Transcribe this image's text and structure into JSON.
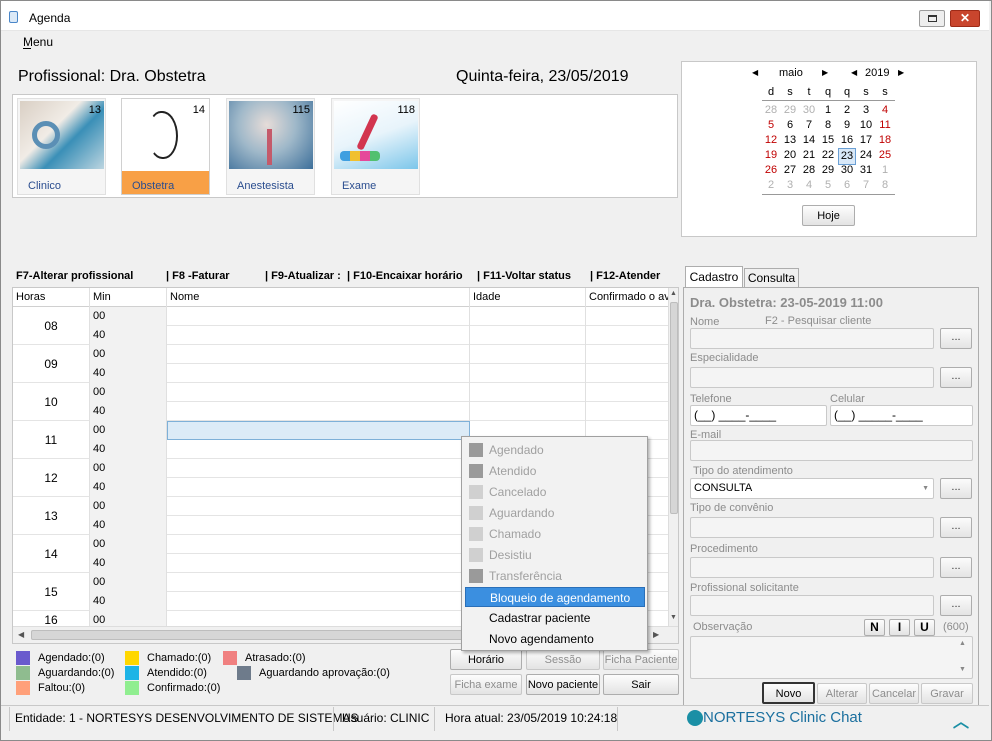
{
  "window": {
    "title": "Agenda",
    "menu": "Menu"
  },
  "header": {
    "profissional": "Profissional: Dra. Obstetra",
    "date": "Quinta-feira, 23/05/2019"
  },
  "categories": [
    {
      "label": "Clinico",
      "count": "13"
    },
    {
      "label": "Obstetra",
      "count": "14"
    },
    {
      "label": "Anestesista",
      "count": "115"
    },
    {
      "label": "Exame",
      "count": "118"
    }
  ],
  "calendar": {
    "month": "maio",
    "year": "2019",
    "weekdays": [
      "d",
      "s",
      "t",
      "q",
      "q",
      "s",
      "s"
    ],
    "weeks": [
      [
        "28",
        "29",
        "30",
        "1",
        "2",
        "3",
        "4"
      ],
      [
        "5",
        "6",
        "7",
        "8",
        "9",
        "10",
        "11"
      ],
      [
        "12",
        "13",
        "14",
        "15",
        "16",
        "17",
        "18"
      ],
      [
        "19",
        "20",
        "21",
        "22",
        "23",
        "24",
        "25"
      ],
      [
        "26",
        "27",
        "28",
        "29",
        "30",
        "31",
        "1"
      ],
      [
        "2",
        "3",
        "4",
        "5",
        "6",
        "7",
        "8"
      ]
    ],
    "today_button": "Hoje"
  },
  "shortcuts": {
    "f7": "F7-Alterar profissional",
    "f8": "| F8 -Faturar",
    "f9": "| F9-Atualizar :",
    "f10": "| F10-Encaixar horário",
    "f11": "| F11-Voltar status",
    "f12": "| F12-Atender"
  },
  "grid": {
    "columns": [
      "Horas",
      "Min",
      "Nome",
      "Idade",
      "Confirmado o av"
    ],
    "rows": [
      {
        "hour": "08",
        "mins": [
          "00",
          "40"
        ]
      },
      {
        "hour": "09",
        "mins": [
          "00",
          "40"
        ]
      },
      {
        "hour": "10",
        "mins": [
          "00",
          "40"
        ]
      },
      {
        "hour": "11",
        "mins": [
          "00",
          "40"
        ]
      },
      {
        "hour": "12",
        "mins": [
          "00",
          "40"
        ]
      },
      {
        "hour": "13",
        "mins": [
          "00",
          "40"
        ]
      },
      {
        "hour": "14",
        "mins": [
          "00",
          "40"
        ]
      },
      {
        "hour": "15",
        "mins": [
          "00",
          "40"
        ]
      },
      {
        "hour": "16",
        "mins": [
          "00"
        ]
      }
    ]
  },
  "context_menu": [
    "Agendado",
    "Atendido",
    "Cancelado",
    "Aguardando",
    "Chamado",
    "Desistiu",
    "Transferência",
    "Bloqueio de agendamento",
    "Cadastrar paciente",
    "Novo agendamento"
  ],
  "legend": {
    "agendado": "Agendado:(0)",
    "aguardando": "Aguardando:(0)",
    "faltou": "Faltou:(0)",
    "chamado": "Chamado:(0)",
    "atendido": "Atendido:(0)",
    "confirmado": "Confirmado:(0)",
    "atrasado": "Atrasado:(0)",
    "aguardando_aprov": "Aguardando aprovação:(0)"
  },
  "colors": {
    "agendado": "#6a5acd",
    "aguardando": "#8fbc8f",
    "faltou": "#ffa07a",
    "chamado": "#ffd700",
    "atendido": "#1eb4e6",
    "confirmado": "#90ee90",
    "atrasado": "#f08080",
    "aguardando_aprov": "#6e7b8b"
  },
  "actions": {
    "horario": "Horário",
    "sessao": "Sessão",
    "ficha_paciente": "Ficha Paciente",
    "ficha_exame": "Ficha exame",
    "novo_paciente": "Novo paciente",
    "sair": "Sair"
  },
  "form": {
    "tabs": [
      "Cadastro",
      "Consulta"
    ],
    "heading": "Dra. Obstetra: 23-05-2019 11:00",
    "nome": "Nome",
    "pesquisar": "F2 - Pesquisar cliente",
    "especialidade": "Especialidade",
    "telefone": "Telefone",
    "celular": "Celular",
    "telefone_mask": "(__) ____-____",
    "celular_mask": "(__) _____-____",
    "email": "E-mail",
    "tipo_atendimento": "Tipo do atendimento",
    "tipo_atendimento_value": "CONSULTA",
    "tipo_convenio": "Tipo de convênio",
    "procedimento": "Procedimento",
    "profissional_solicitante": "Profissional solicitante",
    "observacao": "Observação",
    "fmt_n": "N",
    "fmt_i": "I",
    "fmt_u": "U",
    "char_count": "(600)",
    "dots": "...",
    "buttons": {
      "novo": "Novo",
      "alterar": "Alterar",
      "cancelar": "Cancelar",
      "gravar": "Gravar"
    }
  },
  "status": {
    "entidade": "Entidade: 1 - NORTESYS DESENVOLVIMENTO DE SISTEMAS",
    "usuario": "Usuário: CLINIC",
    "hora": "Hora atual: 23/05/2019 10:24:18",
    "chat": "NORTESYS Clinic Chat"
  }
}
